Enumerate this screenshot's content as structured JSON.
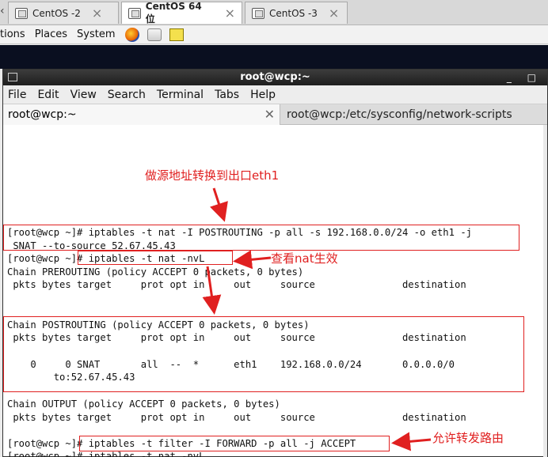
{
  "host_tabs": [
    {
      "label": "CentOS -2",
      "active": false
    },
    {
      "label": "CentOS 64 位",
      "active": true
    },
    {
      "label": "CentOS -3",
      "active": false
    }
  ],
  "panel": {
    "menus": [
      "tions",
      "Places",
      "System"
    ]
  },
  "window": {
    "title": "root@wcp:~",
    "menus": [
      "File",
      "Edit",
      "View",
      "Search",
      "Terminal",
      "Tabs",
      "Help"
    ],
    "tabs": [
      {
        "label": "root@wcp:~",
        "active": true
      },
      {
        "label": "root@wcp:/etc/sysconfig/network-scripts",
        "active": false
      }
    ]
  },
  "terminal": {
    "lines": [
      "[root@wcp ~]# iptables -t nat -I POSTROUTING -p all -s 192.168.0.0/24 -o eth1 -j",
      " SNAT --to-source 52.67.45.43",
      "[root@wcp ~]# iptables -t nat -nvL",
      "Chain PREROUTING (policy ACCEPT 0 packets, 0 bytes)",
      " pkts bytes target     prot opt in     out     source               destination",
      "",
      "",
      "Chain POSTROUTING (policy ACCEPT 0 packets, 0 bytes)",
      " pkts bytes target     prot opt in     out     source               destination",
      "",
      "    0     0 SNAT       all  --  *      eth1    192.168.0.0/24       0.0.0.0/0",
      "        to:52.67.45.43",
      "",
      "Chain OUTPUT (policy ACCEPT 0 packets, 0 bytes)",
      " pkts bytes target     prot opt in     out     source               destination",
      "",
      "[root@wcp ~]# iptables -t filter -I FORWARD -p all -j ACCEPT",
      "[root@wcp ~]# iptables -t nat -nvL"
    ]
  },
  "annotations": {
    "snat": "做源地址转换到出口eth1",
    "check": "查看nat生效",
    "forward": "允许转发路由",
    "color": "#e02020"
  }
}
